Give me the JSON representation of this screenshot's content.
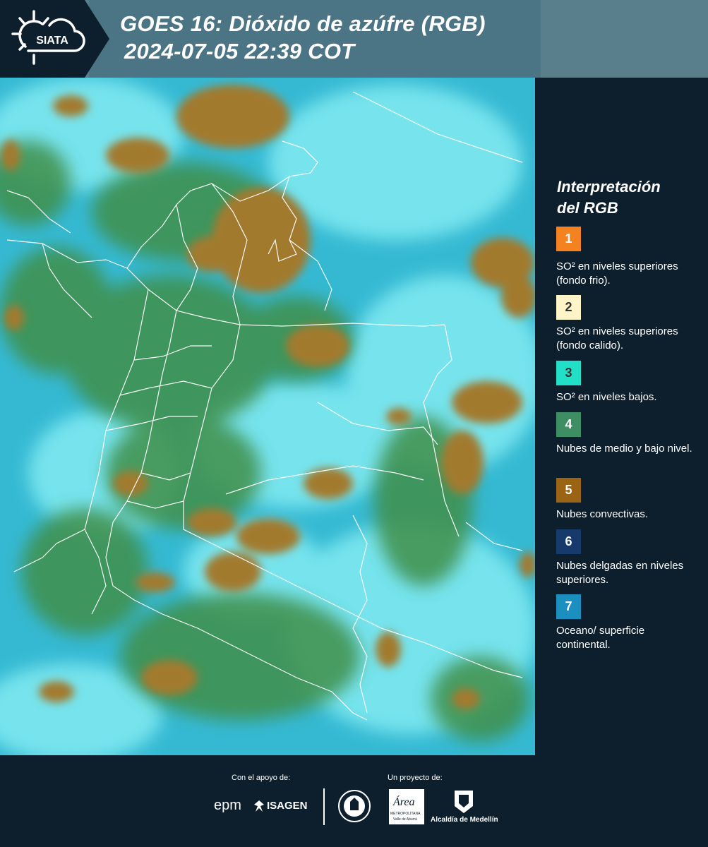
{
  "header": {
    "logo_text": "SIATA",
    "title_line1": "GOES 16: Dióxido de azúfre (RGB)",
    "title_line2": "2024-07-05 22:39 COT"
  },
  "legend": {
    "title_line1": "Interpretación",
    "title_line2": "del RGB",
    "items": [
      {
        "number": "1",
        "color": "#f58220",
        "text": "SO² en niveles superiores (fondo frio)."
      },
      {
        "number": "2",
        "color": "#fdf5c8",
        "text": "SO² en niveles superiores (fondo calido)."
      },
      {
        "number": "3",
        "color": "#22e0c8",
        "text": "SO² en niveles bajos."
      },
      {
        "number": "4",
        "color": "#3e8e63",
        "text": "Nubes de medio y bajo nivel."
      },
      {
        "number": "5",
        "color": "#9a6414",
        "text": "Nubes convectivas."
      },
      {
        "number": "6",
        "color": "#163a6b",
        "text": "Nubes delgadas en niveles superiores."
      },
      {
        "number": "7",
        "color": "#1a8fc0",
        "text": "Oceano/ superficie continental."
      }
    ]
  },
  "footer": {
    "support_label": "Con el apoyo de:",
    "project_label": "Un proyecto de:",
    "sponsors": [
      "epm",
      "ISAGEN"
    ],
    "partners": [
      "Área Metropolitana Valle de Aburrá",
      "Alcaldía de Medellín"
    ],
    "alcaldia_label": "Alcaldía de Medellín",
    "area_label": "Área",
    "area_sub": "METROPOLITANA",
    "area_sub2": "Valle de Aburrá"
  },
  "map": {
    "colors": {
      "background": "#35b9d3",
      "cyan": "#6fe3ef",
      "green": "#3f8f4a",
      "brown": "#a27a2e",
      "border": "#ffffff"
    }
  }
}
